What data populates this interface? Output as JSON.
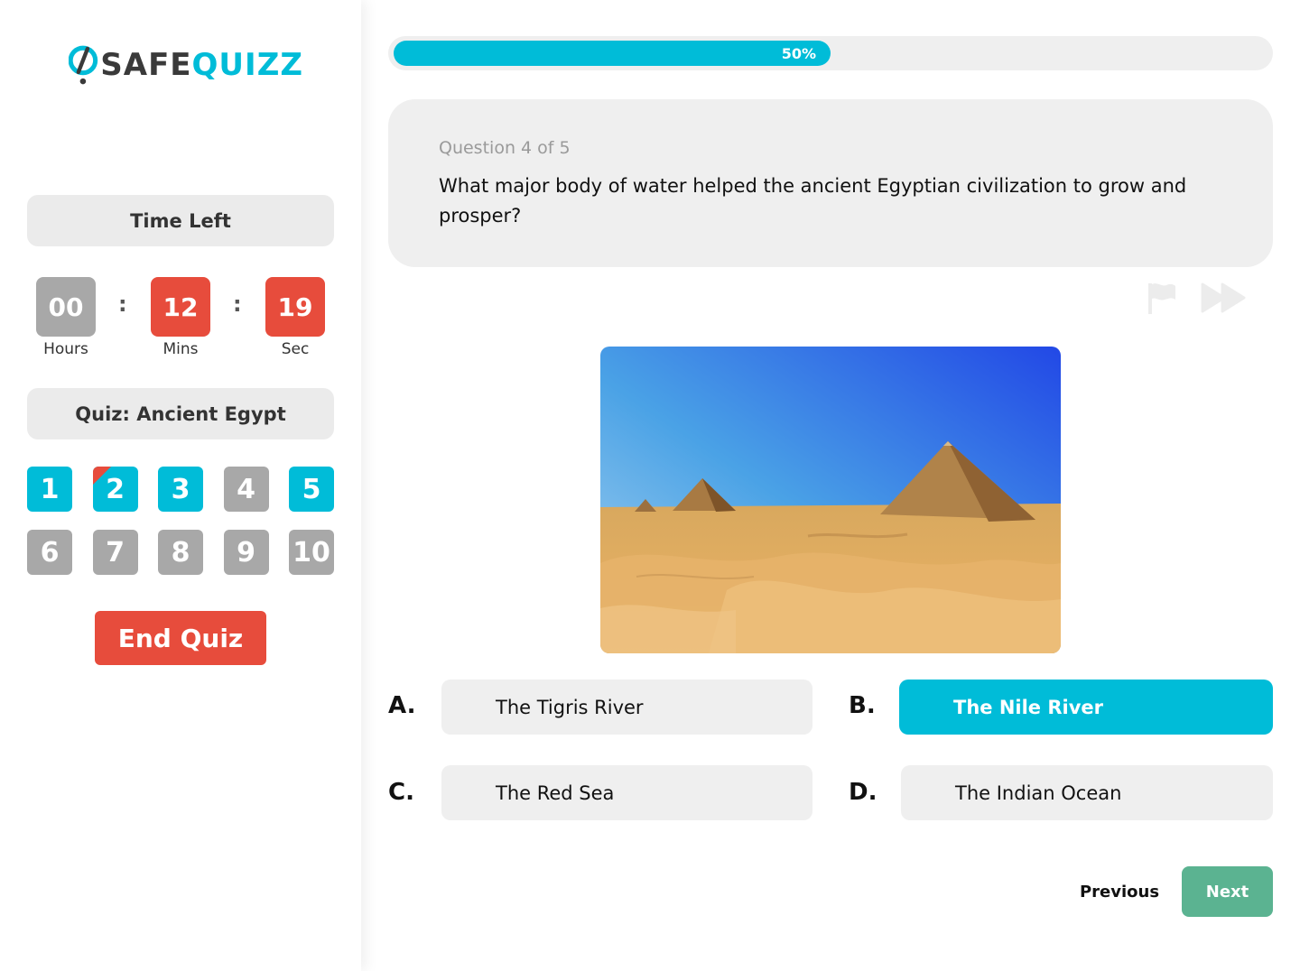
{
  "brand": {
    "name_part1": "SAFE",
    "name_part2": "QUIZZ",
    "primary_color": "#00bcd8",
    "dark_color": "#3a3a3a"
  },
  "sidebar": {
    "time_left_label": "Time Left",
    "timer": {
      "hours": "00",
      "hours_label": "Hours",
      "mins": "12",
      "mins_label": "Mins",
      "secs": "19",
      "secs_label": "Sec",
      "separator": ":"
    },
    "quiz_title": "Quiz: Ancient Egypt",
    "questions": [
      {
        "label": "1",
        "state": "answered"
      },
      {
        "label": "2",
        "state": "flagged"
      },
      {
        "label": "3",
        "state": "answered"
      },
      {
        "label": "4",
        "state": "unanswered"
      },
      {
        "label": "5",
        "state": "answered"
      },
      {
        "label": "6",
        "state": "unanswered"
      },
      {
        "label": "7",
        "state": "unanswered"
      },
      {
        "label": "8",
        "state": "unanswered"
      },
      {
        "label": "9",
        "state": "unanswered"
      },
      {
        "label": "10",
        "state": "unanswered"
      }
    ],
    "end_quiz_label": "End Quiz"
  },
  "progress": {
    "percent": 50,
    "label": "50%"
  },
  "question": {
    "counter": "Question 4 of 5",
    "text": "What major body of water helped the ancient Egyptian civilization to grow and prosper?",
    "icons": [
      "flag-icon",
      "skip-forward-icon"
    ]
  },
  "options": [
    {
      "letter": "A.",
      "text": "The Tigris River",
      "selected": false
    },
    {
      "letter": "B.",
      "text": "The Nile River",
      "selected": true
    },
    {
      "letter": "C.",
      "text": "The Red Sea",
      "selected": false
    },
    {
      "letter": "D.",
      "text": "The Indian Ocean",
      "selected": false
    }
  ],
  "nav": {
    "previous_label": "Previous",
    "next_label": "Next"
  },
  "colors": {
    "red": "#e74c3c",
    "grey": "#a8a8a8",
    "green": "#5bb391",
    "panel": "#efefef"
  }
}
